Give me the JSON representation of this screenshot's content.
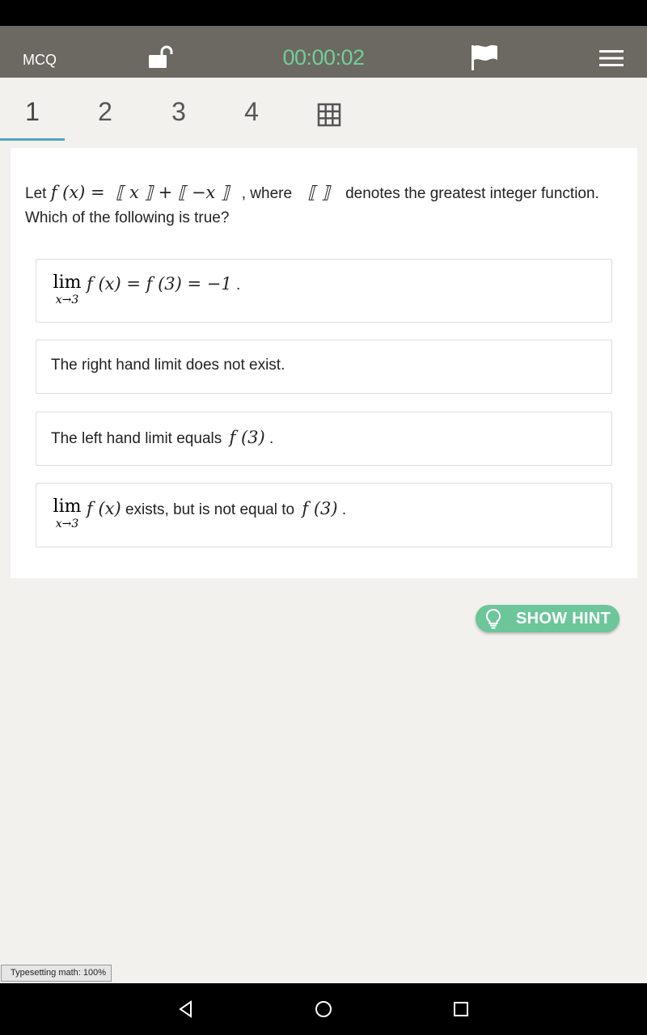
{
  "header": {
    "mode_label": "MCQ",
    "timer": "00:00:02",
    "icons": {
      "lock": "unlock-icon",
      "flag": "flag-icon",
      "menu": "hamburger-menu-icon"
    },
    "timer_color": "#6fcf97",
    "bar_color": "#6c6862"
  },
  "tabs": [
    {
      "label": "1",
      "active": true
    },
    {
      "label": "2",
      "active": false
    },
    {
      "label": "3",
      "active": false
    },
    {
      "label": "4",
      "active": false
    }
  ],
  "grid_icon": "grid-icon",
  "question": {
    "prefix": "Let",
    "func": "f (x) =",
    "expr": "⟦ x ⟧  +  ⟦ −x ⟧",
    "middle": ", where",
    "bracket": "⟦ ⟧",
    "suffix": "denotes the greatest integer function. Which of the following is true?"
  },
  "options": [
    {
      "lim_word": "lim",
      "lim_sub": "x→3",
      "math": "f (x) = f (3) = −1",
      "trail": "."
    },
    {
      "text": "The right hand limit does not exist."
    },
    {
      "text": "The left hand limit equals",
      "math": "f (3)",
      "trail": "."
    },
    {
      "lim_word": "lim",
      "lim_sub": "x→3",
      "math": "f (x)",
      "text": "exists, but is not equal to",
      "math2": "f (3)",
      "trail": "."
    }
  ],
  "hint": {
    "label": "SHOW HINT",
    "icon": "lightbulb-icon",
    "color": "#6cc69a"
  },
  "typeset_status": "Typesetting math: 100%",
  "accent_color": "#4fa3c7"
}
